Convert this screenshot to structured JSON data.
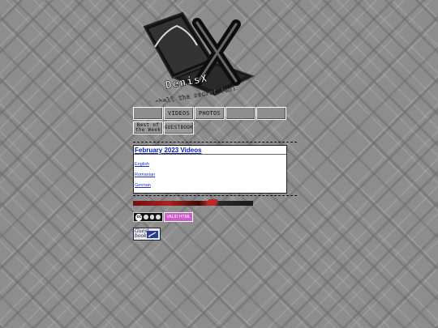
{
  "logo": {
    "title": "DenisX",
    "slogan": "Here shall the secret fun!",
    "x_glyph": "X"
  },
  "nav": {
    "row1": [
      {
        "label": "",
        "icon": "blank-button-icon"
      },
      {
        "label": "VIDEOS",
        "icon": ""
      },
      {
        "label": "PHOTOS",
        "icon": ""
      },
      {
        "label": "",
        "icon": "blank-button-icon"
      },
      {
        "label": "",
        "icon": "blank-button-icon"
      }
    ],
    "row2": [
      {
        "label": "Best of the Week"
      },
      {
        "label": "GUESTBOOK"
      }
    ]
  },
  "content": {
    "title": "February 2023 Videos",
    "links": [
      "English",
      "Romanian",
      "German"
    ]
  },
  "footer": {
    "cc_label": "cc",
    "valid_label": "VALID HTML",
    "guestbook_label": "Guest book"
  },
  "colors": {
    "background": "#8d8d8d",
    "link": "#1d2fbf",
    "title": "#0b22a8",
    "accent_bar": "#b02020",
    "valid_badge": "#d05cc8"
  }
}
